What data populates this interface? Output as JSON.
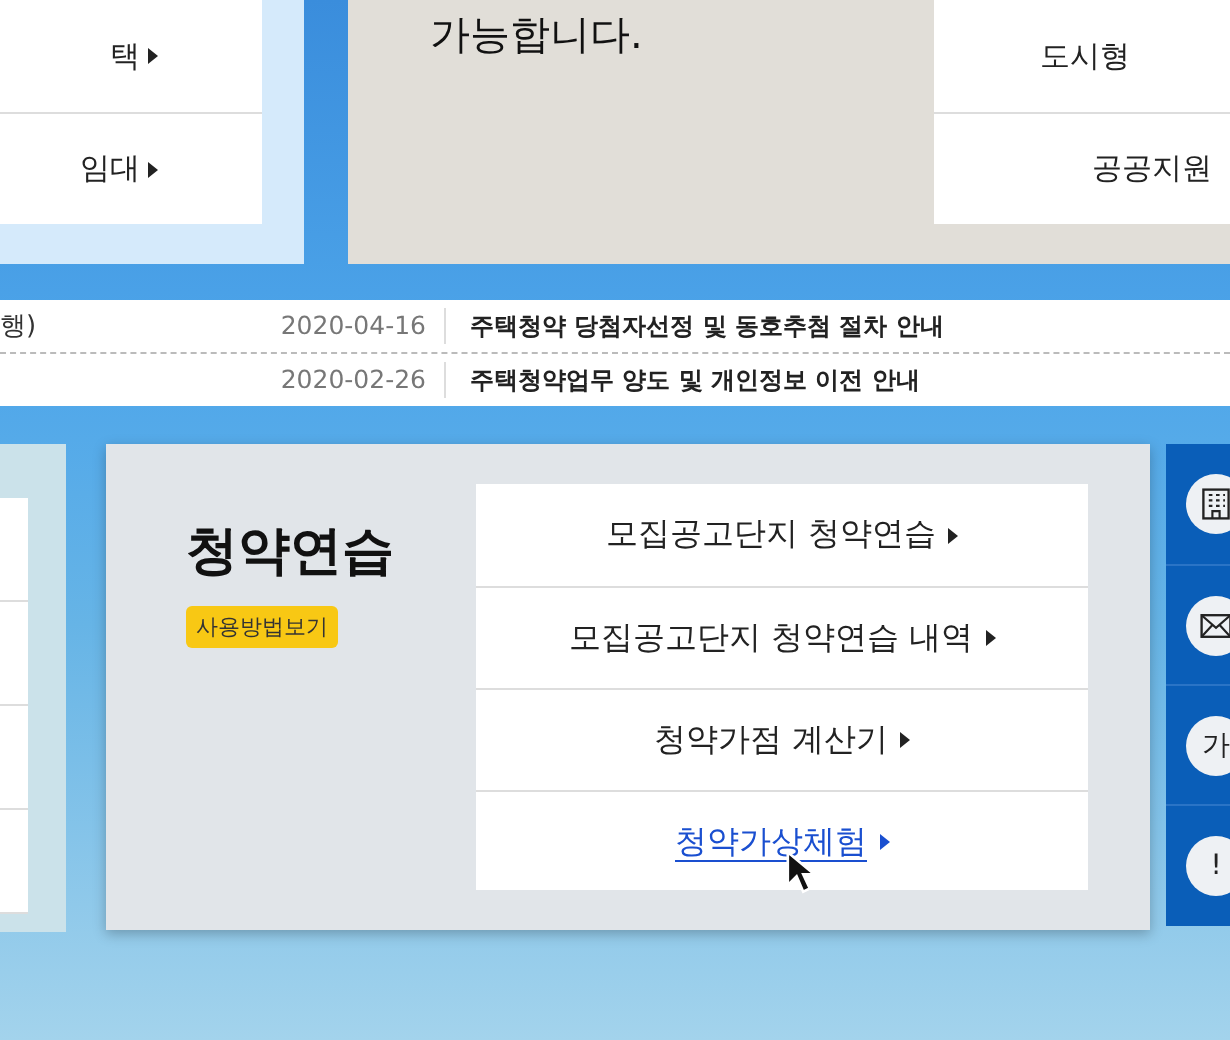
{
  "top_left_menu": [
    {
      "label": "택"
    },
    {
      "label": "임대"
    }
  ],
  "info_card": {
    "text": "가능합니다."
  },
  "top_right_menu": [
    {
      "label": "도시형"
    },
    {
      "label": "공공지원"
    }
  ],
  "notices": [
    {
      "column_1": "행)",
      "date": "2020-04-16",
      "title": "주택청약 당첨자선정 및 동호추첨 절차 안내"
    },
    {
      "date": "2020-02-26",
      "title": "주택청약업무 양도 및 개인정보 이전 안내"
    }
  ],
  "practice": {
    "title": "청약연습",
    "badge": "사용방법보기",
    "links": [
      {
        "label": "모집공고단지 청약연습",
        "selected": false
      },
      {
        "label": "모집공고단지 청약연습 내역",
        "selected": false
      },
      {
        "label": "청약가점 계산기",
        "selected": false
      },
      {
        "label": "청약가상체험",
        "selected": true
      }
    ]
  },
  "quick_menu": [
    {
      "kind": "building"
    },
    {
      "kind": "mail"
    },
    {
      "kind": "text",
      "label": "가"
    },
    {
      "kind": "text",
      "label": "!"
    }
  ]
}
